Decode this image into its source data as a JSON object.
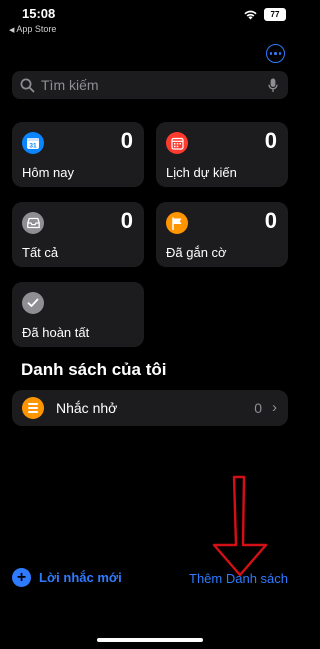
{
  "status_bar": {
    "time": "15:08",
    "back_label": "App Store",
    "battery": "77"
  },
  "search": {
    "placeholder": "Tìm kiếm"
  },
  "smart_lists": [
    {
      "label": "Hôm nay",
      "count": "0",
      "color": "#0a84ff",
      "icon": "calendar-today-icon"
    },
    {
      "label": "Lịch dự kiến",
      "count": "0",
      "color": "#ff3b30",
      "icon": "calendar-grid-icon"
    },
    {
      "label": "Tất cả",
      "count": "0",
      "color": "#8e8e93",
      "icon": "tray-icon"
    },
    {
      "label": "Đã gắn cờ",
      "count": "0",
      "color": "#ff9500",
      "icon": "flag-icon"
    },
    {
      "label": "Đã hoàn tất",
      "color": "#8e8e93",
      "icon": "checkmark-icon"
    }
  ],
  "today_day": "31",
  "my_lists": {
    "title": "Danh sách của tôi",
    "items": [
      {
        "label": "Nhắc nhở",
        "count": "0",
        "color": "#ff9500",
        "icon": "list-icon"
      }
    ]
  },
  "toolbar": {
    "new_reminder": "Lời nhắc mới",
    "add_list": "Thêm Danh sách"
  },
  "colors": {
    "accent": "#2f7bff",
    "background": "#000000",
    "card": "#1c1c1e"
  }
}
